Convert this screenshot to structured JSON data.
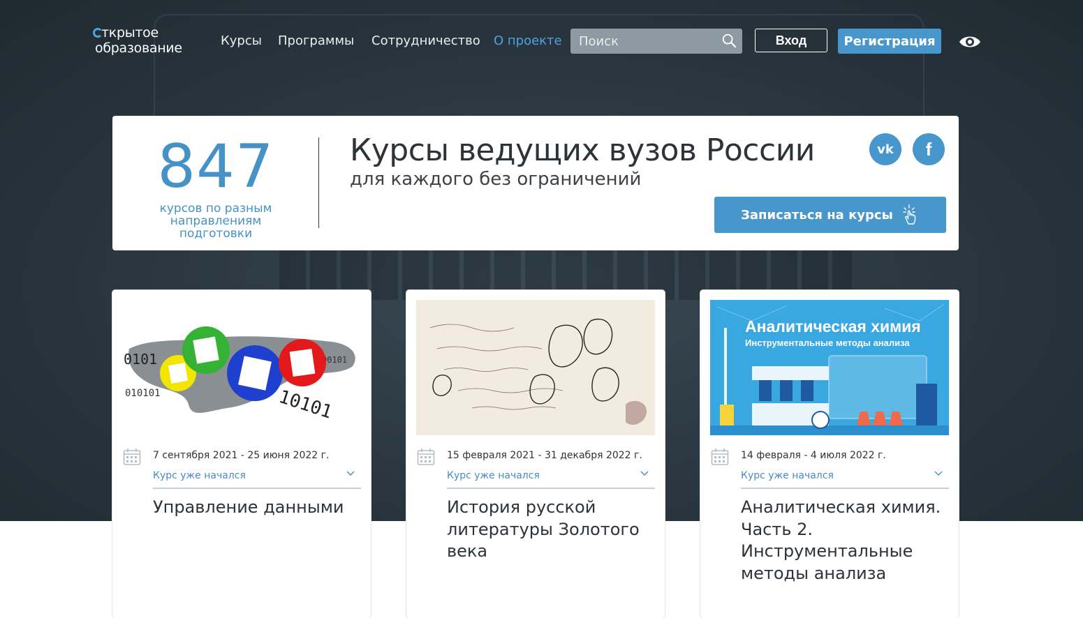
{
  "header": {
    "logo": {
      "line1": "ткрытое",
      "line2": "образование"
    },
    "nav": [
      {
        "label": "Курсы",
        "active": false
      },
      {
        "label": "Программы",
        "active": false
      },
      {
        "label": "Сотрудничество",
        "active": false
      },
      {
        "label": "О проекте",
        "active": true
      }
    ],
    "search": {
      "placeholder": "Поиск",
      "value": ""
    },
    "login_label": "Вход",
    "register_label": "Регистрация"
  },
  "banner": {
    "course_count": "847",
    "count_caption_1": "курсов по разным",
    "count_caption_2": "направлениям подготовки",
    "headline": "Курсы ведущих вузов России",
    "subheadline": "для каждого без ограничений",
    "vk_label": "vk",
    "fb_label": "f",
    "enroll_label": "Записаться на курсы"
  },
  "courses": [
    {
      "dates": "7 сентября 2021 - 25 июня 2022 г.",
      "status": "Курс уже начался",
      "title": "Управление данными"
    },
    {
      "dates": "15 февраля 2021 - 31 декабря 2022 г.",
      "status": "Курс уже начался",
      "title": "История русской литературы Золотого века"
    },
    {
      "dates": "14 февраля - 4 июля 2022 г.",
      "status": "Курс уже начался",
      "title": "Аналитическая химия. Часть 2. Инструментальные методы анализа",
      "image_text_1": "Аналитическая химия",
      "image_text_2": "Инструментальные методы анализа"
    }
  ],
  "colors": {
    "accent": "#4897cc",
    "text": "#2e3338",
    "hero_bg": "#2c3942"
  }
}
